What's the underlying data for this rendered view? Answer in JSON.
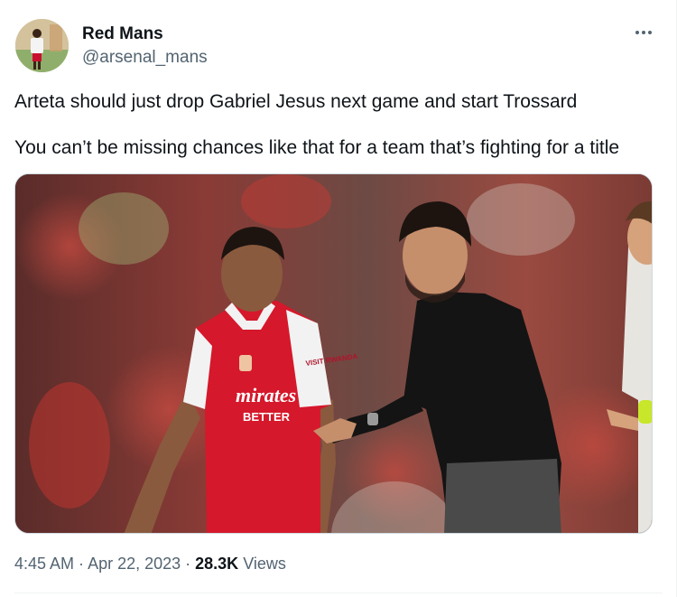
{
  "author": {
    "display_name": "Red Mans",
    "handle": "@arsenal_mans"
  },
  "tweet": {
    "line1": "Arteta should just drop Gabriel Jesus next game and start Trossard",
    "line2": "You can’t be missing chances like that for a team that’s fighting for a title"
  },
  "media": {
    "sponsor_line1": "mirates",
    "sponsor_line2": "BETTER",
    "sleeve_text": "VISIT RWANDA"
  },
  "meta": {
    "time": "4:45 AM",
    "separator": " · ",
    "date": "Apr 22, 2023",
    "views_count": "28.3K",
    "views_label": "Views"
  },
  "icons": {
    "more": "more-horizontal-icon"
  },
  "colors": {
    "text_primary": "#0f1419",
    "text_secondary": "#536471",
    "border": "#cfd9de",
    "arsenal_red": "#d5182b"
  }
}
